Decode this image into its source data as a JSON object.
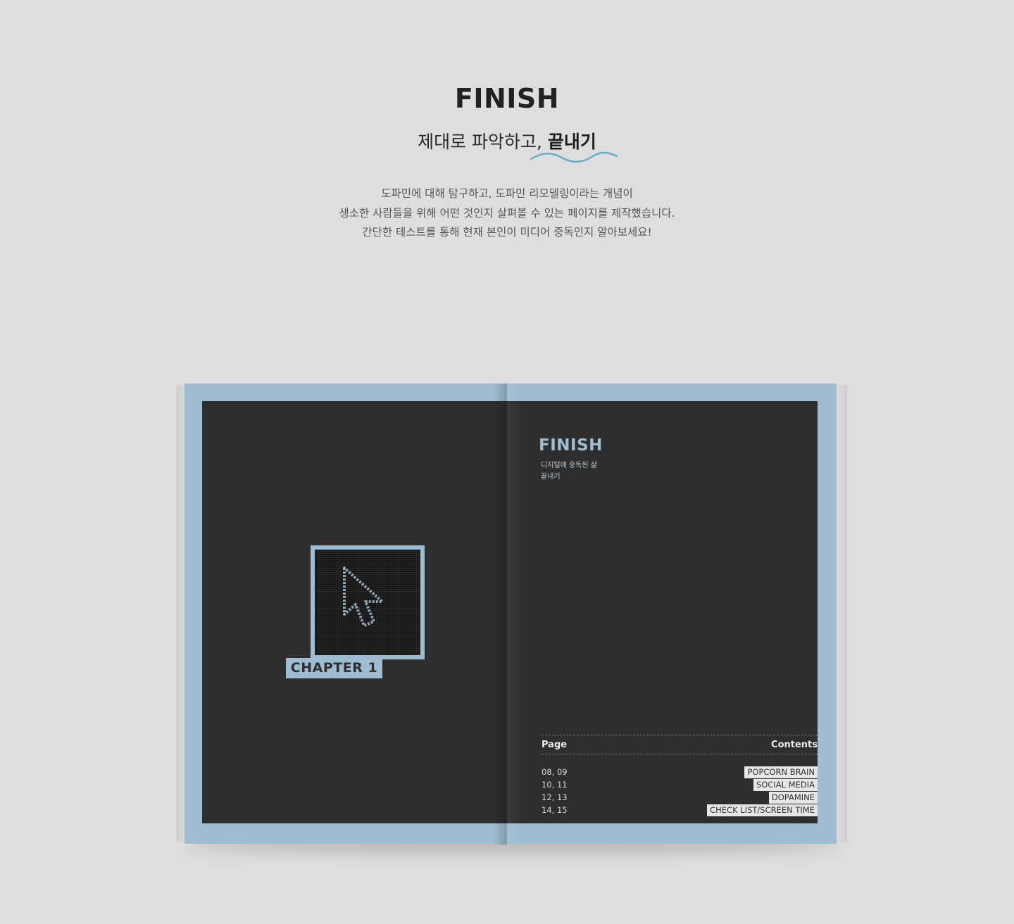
{
  "header": {
    "title": "FINISH",
    "subtitle_plain": "제대로 파악하고,",
    "subtitle_bold": "끝내기",
    "description": [
      "도파민에 대해 탐구하고, 도파민 리모델링이라는 개념이",
      "생소한 사람들을 위해 어떤 것인지 살펴볼 수 있는 페이지를 제작했습니다.",
      "간단한 테스트를 통해 현재 본인이 미디어 중독인지 알아보세요!"
    ]
  },
  "book": {
    "left_page": {
      "chapter_label": "CHAPTER 1",
      "icon": "cursor-arrow-icon"
    },
    "right_page": {
      "title": "FINISH",
      "subtitle_lines": [
        "디지털에 중독된 삶",
        "끝내기"
      ],
      "toc": {
        "page_header": "Page",
        "contents_header": "Contents",
        "rows": [
          {
            "page": "08, 09",
            "content": "POPCORN BRAIN"
          },
          {
            "page": "10, 11",
            "content": "SOCIAL MEDIA"
          },
          {
            "page": "12, 13",
            "content": "DOPAMINE"
          },
          {
            "page": "14, 15",
            "content": "CHECK LIST/SCREEN TIME"
          }
        ]
      }
    }
  },
  "colors": {
    "background": "#dedede",
    "accent_blue": "#9fbdd0",
    "page_dark": "#2e2e2e",
    "wave": "#6aaec6"
  }
}
